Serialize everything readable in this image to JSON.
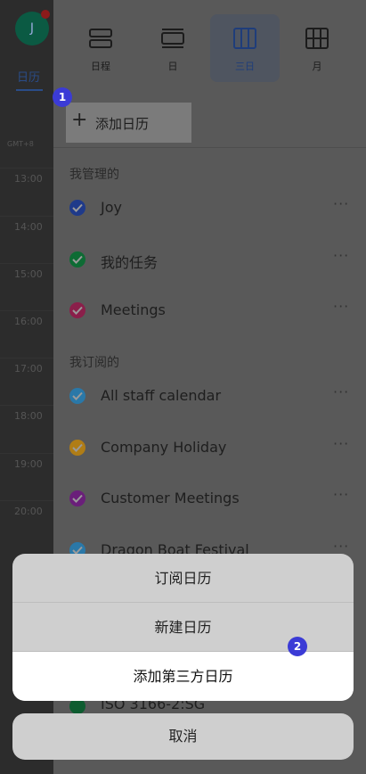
{
  "background_calendar": {
    "avatar_initial": "J",
    "tab_label": "日历",
    "timezone_label": "GMT+8",
    "hours": [
      "13:00",
      "14:00",
      "15:00",
      "16:00",
      "17:00",
      "18:00",
      "19:00",
      "20:00"
    ]
  },
  "view_switcher": {
    "items": [
      {
        "label": "日程",
        "icon": "schedule-list-icon",
        "active": false
      },
      {
        "label": "日",
        "icon": "day-view-icon",
        "active": false
      },
      {
        "label": "三日",
        "icon": "three-day-view-icon",
        "active": true
      },
      {
        "label": "月",
        "icon": "month-grid-icon",
        "active": false
      }
    ]
  },
  "add_calendar": {
    "label": "添加日历",
    "icon": "plus-icon"
  },
  "sections": {
    "managed": {
      "title": "我管理的",
      "calendars": [
        {
          "name": "Joy",
          "color": "#1f3a8a"
        },
        {
          "name": "我的任务",
          "color": "#0e6b34"
        },
        {
          "name": "Meetings",
          "color": "#8a1f4a"
        }
      ]
    },
    "subscribed": {
      "title": "我订阅的",
      "calendars": [
        {
          "name": "All staff calendar",
          "color": "#2a78a8"
        },
        {
          "name": "Company Holiday",
          "color": "#b07d16"
        },
        {
          "name": "Customer Meetings",
          "color": "#6a1f7a"
        },
        {
          "name": "Dragon Boat Festival",
          "color": "#2a78a8"
        }
      ]
    },
    "more_label": "···"
  },
  "action_sheet": {
    "items": [
      "订阅日历",
      "新建日历",
      "添加第三方日历"
    ],
    "cancel": "取消"
  },
  "behind_row": {
    "name": "ISO 3166-2:SG",
    "color": "#0e5c30"
  },
  "annotations": [
    "1",
    "2"
  ],
  "colors": {
    "accent": "#3b3bd6",
    "active_view": "#1f3d7a"
  }
}
